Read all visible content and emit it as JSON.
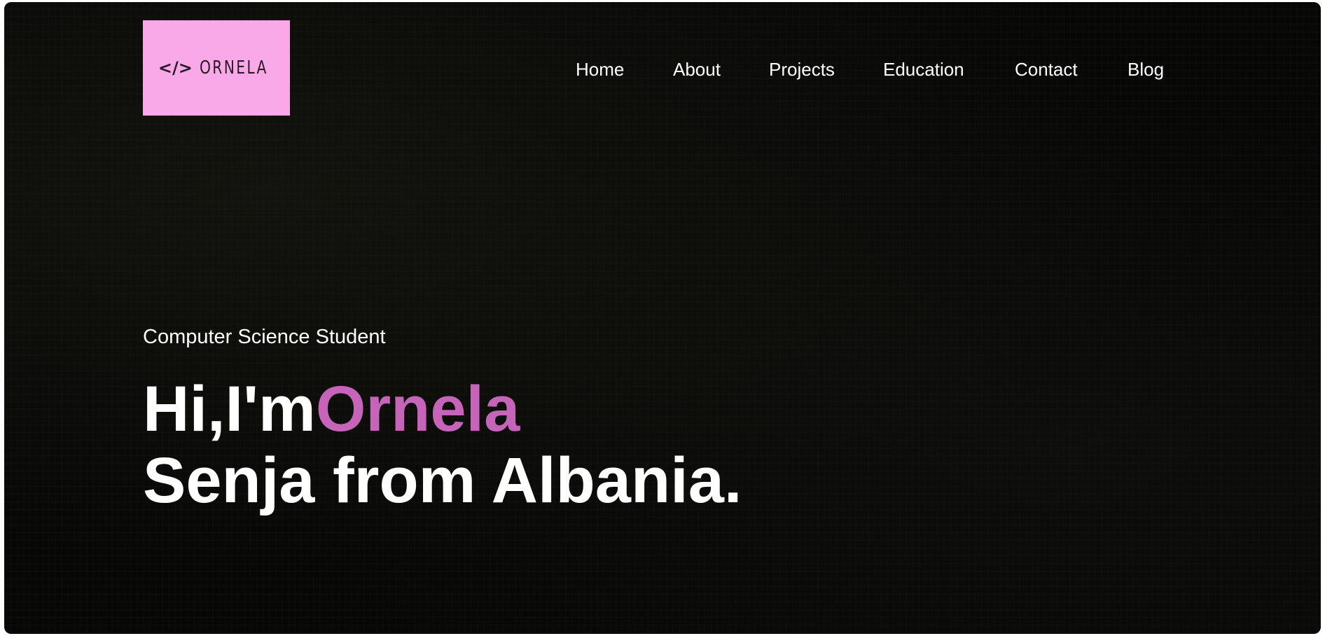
{
  "logo": {
    "icon": "</>",
    "text": "ORNELA",
    "background": "#f9a8e8"
  },
  "nav": {
    "items": [
      {
        "label": "Home"
      },
      {
        "label": "About"
      },
      {
        "label": "Projects"
      },
      {
        "label": "Education"
      },
      {
        "label": "Contact"
      },
      {
        "label": "Blog"
      }
    ]
  },
  "hero": {
    "subtitle": "Computer Science Student",
    "greeting": "Hi,I'm",
    "name": "Ornela",
    "line2": "Senja from Albania.",
    "accent_color": "#c564b8",
    "background": "#070706"
  }
}
